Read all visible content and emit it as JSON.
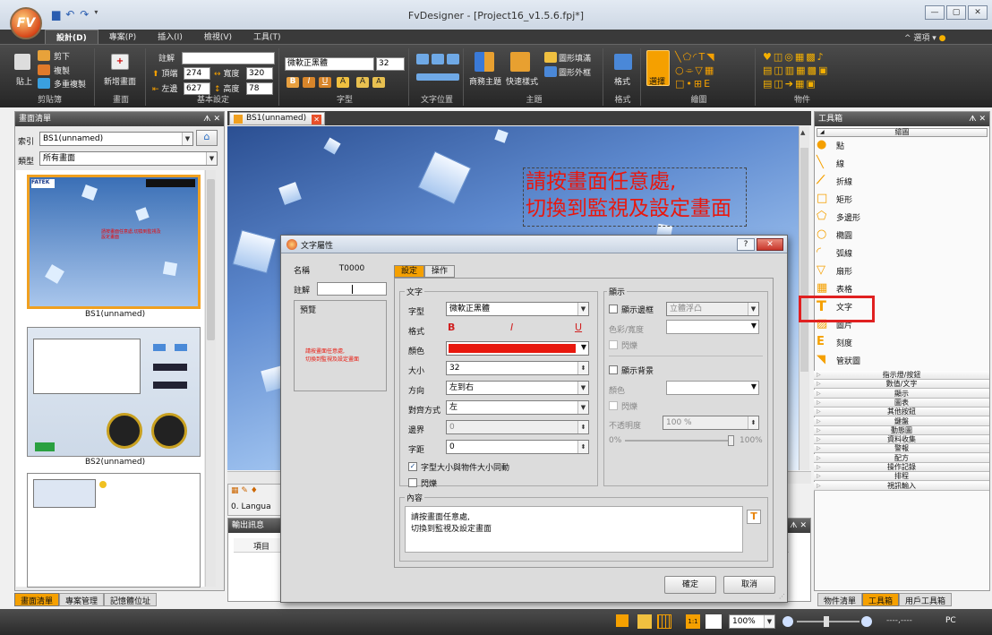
{
  "window": {
    "title": "FvDesigner - [Project16_v1.5.6.fpj*]",
    "app_icon": "FV",
    "top_right_link": "選項",
    "colors": {
      "ribbon": "#2e2e2e",
      "accent_red": "#e8180e",
      "canvas_sky": "#5b86c2"
    }
  },
  "ribbon_tabs": [
    "設計(D)",
    "專案(P)",
    "插入(I)",
    "檢視(V)",
    "工具(T)"
  ],
  "ribbon": {
    "clipboard": {
      "group": "剪貼簿",
      "paste": "貼上",
      "cut": "剪下",
      "copy": "複製",
      "multi_copy": "多重複製"
    },
    "screen": {
      "group": "畫面",
      "new_screen": "新增畫面"
    },
    "basic": {
      "group": "基本設定",
      "comment_label": "註解",
      "top_label": "頂端",
      "top_value": "274",
      "width_label": "寬度",
      "width_value": "320",
      "left_label": "左邊",
      "left_value": "627",
      "height_label": "高度",
      "height_value": "78"
    },
    "font": {
      "group": "字型",
      "font_name": "微軟正黑體",
      "font_size": "32"
    },
    "textpos": {
      "group": "文字位置"
    },
    "theme": {
      "group": "主題",
      "theme_btn": "商務主題",
      "quick_style": "快速樣式",
      "fill": "圖形填滿",
      "outline": "圖形外框"
    },
    "format": {
      "group": "格式",
      "label": "格式"
    },
    "draw": {
      "group": "繪圖",
      "select": "選擇"
    },
    "object": {
      "group": "物件"
    }
  },
  "screen_list": {
    "title": "畫面清單",
    "index_label": "索引",
    "index_value": "BS1(unnamed)",
    "type_label": "類型",
    "type_value": "所有畫面",
    "thumbnails": [
      {
        "label": "BS1(unnamed)",
        "text": "請按畫面任意處,切換到監視及設定畫面"
      },
      {
        "label": "BS2(unnamed)"
      },
      {
        "label": ""
      }
    ],
    "bottom_tabs": [
      "畫面清單",
      "專案管理",
      "記憶體位址"
    ]
  },
  "editor": {
    "tab": "BS1(unnamed)",
    "canvas_text_line1": "請按畫面任意處,",
    "canvas_text_line2": "切換到監視及設定畫面",
    "lang_row": "0. Langua",
    "output_title": "輸出訊息",
    "output_col": "項目"
  },
  "toolbox": {
    "title": "工具箱",
    "section": "繪圖",
    "items": [
      {
        "label": "點",
        "icon": "dot-icon"
      },
      {
        "label": "線",
        "icon": "line-icon"
      },
      {
        "label": "折線",
        "icon": "polyline-icon"
      },
      {
        "label": "矩形",
        "icon": "rectangle-icon"
      },
      {
        "label": "多邊形",
        "icon": "polygon-icon"
      },
      {
        "label": "橢圓",
        "icon": "ellipse-icon"
      },
      {
        "label": "弧線",
        "icon": "arc-icon"
      },
      {
        "label": "扇形",
        "icon": "sector-icon"
      },
      {
        "label": "表格",
        "icon": "table-icon"
      },
      {
        "label": "文字",
        "icon": "text-icon"
      },
      {
        "label": "圖片",
        "icon": "picture-icon"
      },
      {
        "label": "刻度",
        "icon": "scale-icon"
      },
      {
        "label": "管狀圖",
        "icon": "pipe-icon"
      }
    ],
    "categories": [
      "指示燈/按鈕",
      "數值/文字",
      "顯示",
      "圖表",
      "其他按鈕",
      "鍵盤",
      "動態圖",
      "資料收集",
      "警報",
      "配方",
      "操作記錄",
      "排程",
      "視訊輸入"
    ],
    "bottom_tabs": [
      "物件清單",
      "工具箱",
      "用戶工具箱"
    ]
  },
  "dialog": {
    "title": "文字屬性",
    "name_label": "名稱",
    "name_value": "T0000",
    "comment_label": "註解",
    "preview_label": "預覽",
    "preview_text": "請按畫面任意處,\n切換到監視及設定畫面",
    "tabs": [
      "設定",
      "操作"
    ],
    "text_section": "文字",
    "font_label": "字型",
    "font_value": "微軟正黑體",
    "style_label": "格式",
    "color_label": "顏色",
    "color_value": "#e8180e",
    "size_label": "大小",
    "size_value": "32",
    "direction_label": "方向",
    "direction_value": "左到右",
    "align_label": "對齊方式",
    "align_value": "左",
    "border_label": "邊界",
    "border_value": "0",
    "spacing_label": "字距",
    "spacing_value": "0",
    "autosize_label": "字型大小與物件大小同動",
    "blink_label": "閃爍",
    "display_section": "顯示",
    "show_border_label": "顯示邊框",
    "border_style_value": "立體浮凸",
    "color_width_label": "色彩/寬度",
    "blink2_label": "閃爍",
    "show_bg_label": "顯示背景",
    "bg_color_label": "顏色",
    "blink3_label": "閃爍",
    "opacity_label": "不透明度",
    "opacity_value": "100 %",
    "opacity_min": "0%",
    "opacity_max": "100%",
    "opacity_level": 1.0,
    "content_section": "內容",
    "content_text": "請按畫面任意處,\n切換到監視及設定畫面",
    "ok": "確定",
    "cancel": "取消"
  },
  "statusbar": {
    "zoom": "100%",
    "coords": "----,----",
    "mode": "PC"
  }
}
